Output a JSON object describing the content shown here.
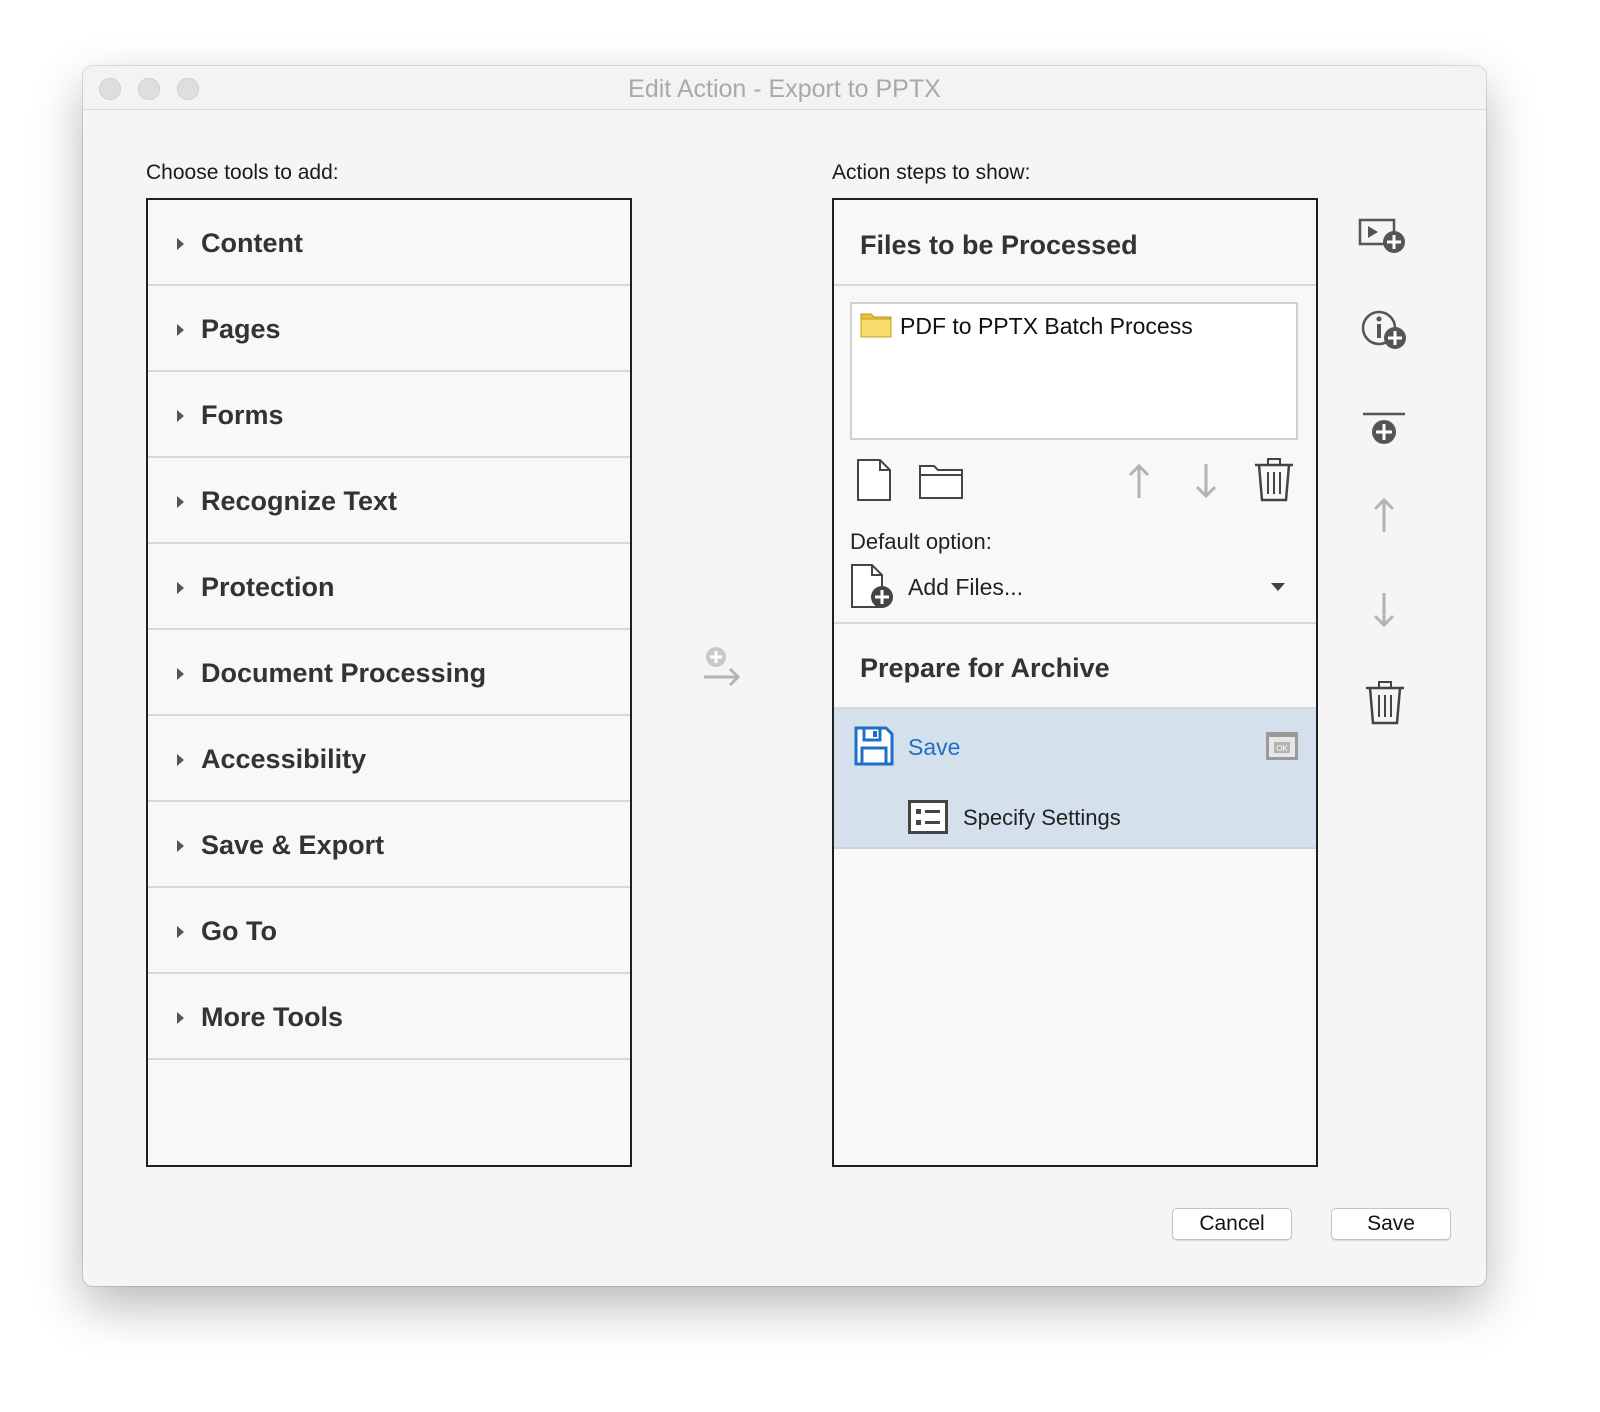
{
  "window": {
    "title": "Edit Action - Export to PPTX"
  },
  "tools": {
    "heading": "Choose tools to add:",
    "items": [
      {
        "label": "Content"
      },
      {
        "label": "Pages"
      },
      {
        "label": "Forms"
      },
      {
        "label": "Recognize Text"
      },
      {
        "label": "Protection"
      },
      {
        "label": "Document Processing"
      },
      {
        "label": "Accessibility"
      },
      {
        "label": "Save & Export"
      },
      {
        "label": "Go To"
      },
      {
        "label": "More Tools"
      }
    ]
  },
  "steps": {
    "heading": "Action steps to show:",
    "files_group": {
      "title": "Files to be Processed",
      "file_item": "PDF to PPTX Batch Process",
      "default_option_label": "Default option:",
      "default_option_value": "Add Files..."
    },
    "archive_group": {
      "title": "Prepare for Archive",
      "step_label": "Save",
      "sub_label": "Specify Settings"
    }
  },
  "footer": {
    "cancel_label": "Cancel",
    "save_label": "Save"
  },
  "icons": {
    "add_arrow": "add-to-steps-icon",
    "side": [
      "insert-pause-icon",
      "add-instruction-icon",
      "add-divider-icon",
      "move-up-icon",
      "move-down-icon",
      "delete-icon"
    ]
  },
  "colors": {
    "selection": "#d4e1ec",
    "link_blue": "#1f6fc8"
  }
}
